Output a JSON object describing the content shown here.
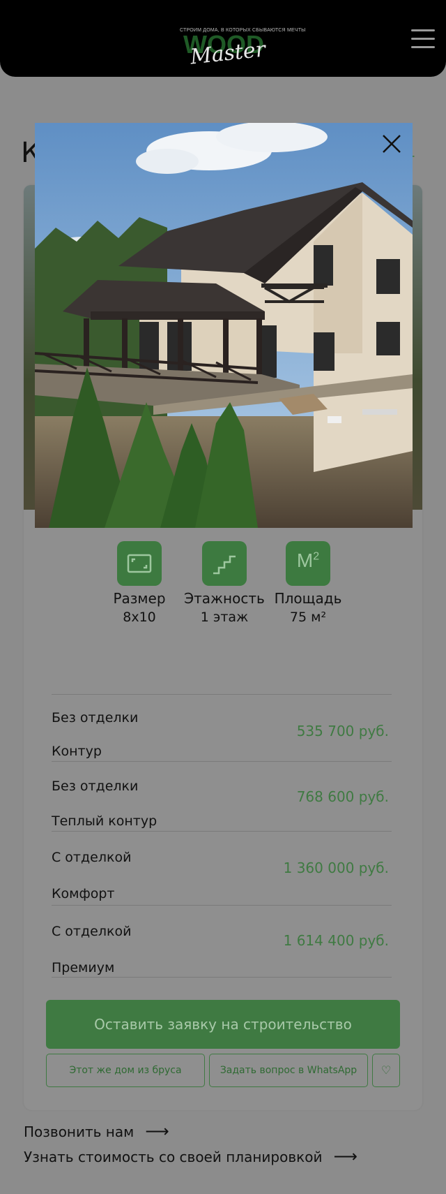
{
  "header": {
    "tagline": "СТРОИМ ДОМА, В КОТОРЫХ СБЫВАЮТСЯ МЕЧТЫ",
    "logo_word_1": "WOOD",
    "logo_word_2": "Master",
    "menu_icon": "hamburger-menu-icon"
  },
  "page": {
    "title_partial": "К",
    "link_partial": "г"
  },
  "lightbox": {
    "close_icon": "close-icon",
    "image": "house-photo"
  },
  "specs": [
    {
      "icon": "size-frame-icon",
      "label": "Размер",
      "value": "8x10"
    },
    {
      "icon": "stairs-icon",
      "label": "Этажность",
      "value": "1 этаж"
    },
    {
      "icon": "area-m2-icon",
      "label": "Площадь",
      "value": "75 м²",
      "icon_text": "М",
      "icon_sup": "2"
    }
  ],
  "prices": [
    {
      "line1": "Без отделки",
      "line2": "Контур",
      "price": "535 700 руб."
    },
    {
      "line1": "Без отделки",
      "line2": "Теплый контур",
      "price": "768 600 руб."
    },
    {
      "line1": "С отделкой",
      "line2": "Комфорт",
      "price": "1 360 000 руб."
    },
    {
      "line1": "С отделкой",
      "line2": "Премиум",
      "price": "1 614 400 руб."
    }
  ],
  "actions": {
    "main_button": "Оставить заявку на строительство",
    "timber_button": "Этот же дом из бруса",
    "whatsapp_button": "Задать вопрос в WhatsApp",
    "favorite_icon": "heart-icon",
    "favorite_glyph": "♡"
  },
  "links": [
    {
      "label": "Позвонить нам",
      "arrow": "⟶"
    },
    {
      "label": "Узнать стоимость со своей планировкой",
      "arrow": "⟶"
    }
  ],
  "colors": {
    "accent": "#3f7a42",
    "header_bg": "#000000",
    "overlay_bg": "#8c8c8c"
  }
}
